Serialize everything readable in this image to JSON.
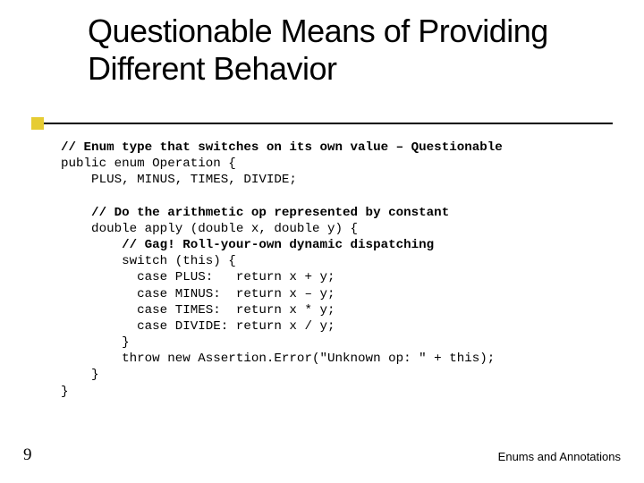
{
  "title": "Questionable Means of Providing Different Behavior",
  "code": {
    "l1": "// Enum type that switches on its own value – Questionable",
    "l2": "public enum Operation {",
    "l3": "    PLUS, MINUS, TIMES, DIVIDE;",
    "l4": "",
    "l5": "    // Do the arithmetic op represented by constant",
    "l6": "    double apply (double x, double y) {",
    "l7": "        // Gag! Roll-your-own dynamic dispatching",
    "l8": "        switch (this) {",
    "l9": "          case PLUS:   return x + y;",
    "l10": "          case MINUS:  return x – y;",
    "l11": "          case TIMES:  return x * y;",
    "l12": "          case DIVIDE: return x / y;",
    "l13": "        }",
    "l14": "        throw new Assertion.Error(\"Unknown op: \" + this);",
    "l15": "    }",
    "l16": "}"
  },
  "page_number": "9",
  "footer": "Enums and Annotations"
}
